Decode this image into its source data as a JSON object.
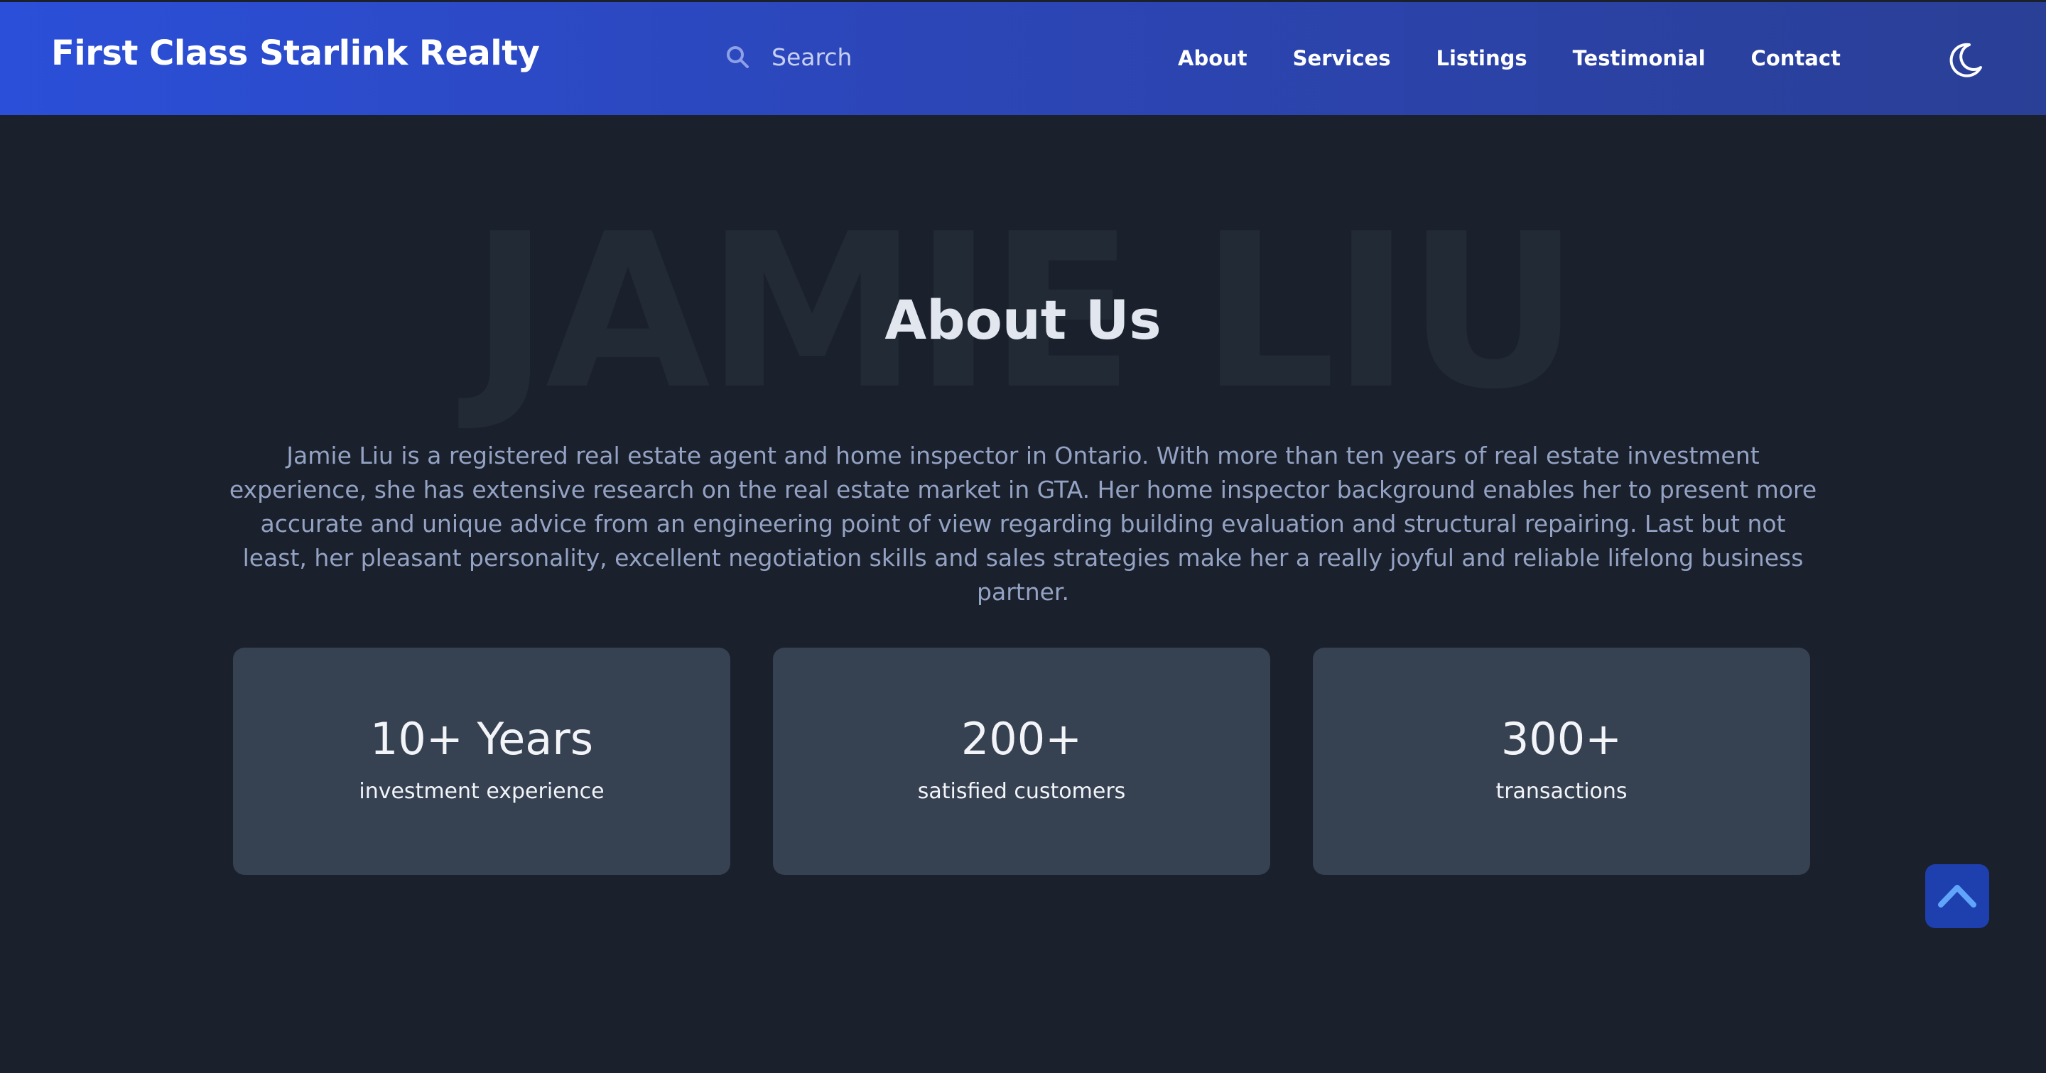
{
  "header": {
    "brand": "First Class Starlink Realty",
    "search": {
      "placeholder": "Search",
      "icon": "search-icon"
    },
    "nav": [
      {
        "label": "About"
      },
      {
        "label": "Services"
      },
      {
        "label": "Listings"
      },
      {
        "label": "Testimonial"
      },
      {
        "label": "Contact"
      }
    ],
    "theme_toggle_icon": "moon-icon"
  },
  "about": {
    "watermark": "JAMIE LIU",
    "title": "About Us",
    "bio": "Jamie Liu is a registered real estate agent and home inspector in Ontario. With more than ten years of real estate investment experience, she has extensive research on the real estate market in GTA. Her home inspector background enables her to present more accurate and unique advice from an engineering point of view regarding building evaluation and structural repairing. Last but not least, her pleasant personality, excellent negotiation skills and sales strategies make her a really joyful and reliable lifelong business partner.",
    "stats": [
      {
        "value": "10+ Years",
        "label": "investment experience"
      },
      {
        "value": "200+",
        "label": "satisfied customers"
      },
      {
        "value": "300+",
        "label": "transactions"
      }
    ]
  },
  "back_to_top_icon": "chevron-up-icon",
  "colors": {
    "header_gradient_start": "#2b4fd8",
    "header_gradient_end": "#2a3f96",
    "page_background": "#1a202c",
    "card_background": "#364152",
    "bio_text": "#94a3c4",
    "back_to_top": "#1e40af",
    "back_to_top_icon": "#60a5fa"
  }
}
